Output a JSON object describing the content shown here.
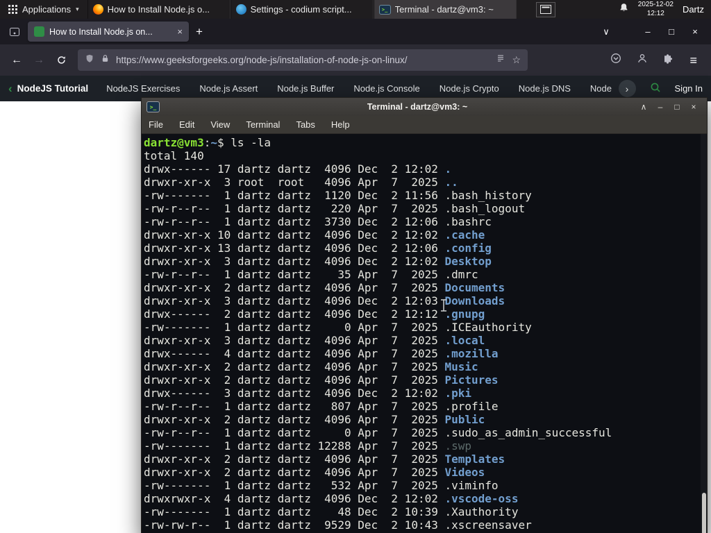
{
  "colors": {
    "terminal_green": "#8ae234",
    "terminal_blue": "#729fcf",
    "gfg_green": "#2f8d46",
    "firefox_orange": "#ff7139"
  },
  "icons": {
    "caret_down": "▾",
    "close": "×",
    "plus": "+",
    "chevron_down": "∨",
    "chevron_up": "∧",
    "chevron_left": "‹",
    "chevron_right": "›",
    "minimize": "–",
    "maximize": "□",
    "back": "←",
    "forward": "→",
    "menu": "≡",
    "star": "☆"
  },
  "panel": {
    "applications_label": "Applications",
    "tasks": [
      {
        "label": "How to Install Node.js o...",
        "app": "firefox"
      },
      {
        "label": "Settings - codium script...",
        "app": "codium"
      },
      {
        "label": "Terminal - dartz@vm3: ~",
        "app": "terminal",
        "active": true
      }
    ],
    "clock_date": "2025-12-02",
    "clock_time": "12:12",
    "user_label": "Dartz"
  },
  "browser": {
    "tab_title": "How to Install Node.js on...",
    "url": "https://www.geeksforgeeks.org/node-js/installation-of-node-js-on-linux/"
  },
  "site_nav": {
    "back_label": "NodeJS Tutorial",
    "items": [
      "NodeJS Exercises",
      "Node.js Assert",
      "Node.js Buffer",
      "Node.js Console",
      "Node.js Crypto",
      "Node.js DNS",
      "Node"
    ],
    "sign_in_label": "Sign In"
  },
  "terminal": {
    "title": "Terminal - dartz@vm3: ~",
    "menu_items": [
      "File",
      "Edit",
      "View",
      "Terminal",
      "Tabs",
      "Help"
    ],
    "prompt": {
      "user_host": "dartz@vm3",
      "separator": ":",
      "cwd": "~",
      "symbol": "$",
      "command": "ls -la"
    },
    "total_line": "total 140",
    "listing": [
      {
        "perms": "drwx------",
        "links": 17,
        "owner": "dartz",
        "group": "dartz",
        "size": 4096,
        "month": "Dec",
        "day": 2,
        "when": "12:02",
        "name": ".",
        "type": "dir"
      },
      {
        "perms": "drwxr-xr-x",
        "links": 3,
        "owner": "root",
        "group": "root",
        "size": 4096,
        "month": "Apr",
        "day": 7,
        "when": "2025",
        "name": "..",
        "type": "dir"
      },
      {
        "perms": "-rw-------",
        "links": 1,
        "owner": "dartz",
        "group": "dartz",
        "size": 1120,
        "month": "Dec",
        "day": 2,
        "when": "11:56",
        "name": ".bash_history",
        "type": "file"
      },
      {
        "perms": "-rw-r--r--",
        "links": 1,
        "owner": "dartz",
        "group": "dartz",
        "size": 220,
        "month": "Apr",
        "day": 7,
        "when": "2025",
        "name": ".bash_logout",
        "type": "file"
      },
      {
        "perms": "-rw-r--r--",
        "links": 1,
        "owner": "dartz",
        "group": "dartz",
        "size": 3730,
        "month": "Dec",
        "day": 2,
        "when": "12:06",
        "name": ".bashrc",
        "type": "file"
      },
      {
        "perms": "drwxr-xr-x",
        "links": 10,
        "owner": "dartz",
        "group": "dartz",
        "size": 4096,
        "month": "Dec",
        "day": 2,
        "when": "12:02",
        "name": ".cache",
        "type": "dir"
      },
      {
        "perms": "drwxr-xr-x",
        "links": 13,
        "owner": "dartz",
        "group": "dartz",
        "size": 4096,
        "month": "Dec",
        "day": 2,
        "when": "12:06",
        "name": ".config",
        "type": "dir"
      },
      {
        "perms": "drwxr-xr-x",
        "links": 3,
        "owner": "dartz",
        "group": "dartz",
        "size": 4096,
        "month": "Dec",
        "day": 2,
        "when": "12:02",
        "name": "Desktop",
        "type": "dir"
      },
      {
        "perms": "-rw-r--r--",
        "links": 1,
        "owner": "dartz",
        "group": "dartz",
        "size": 35,
        "month": "Apr",
        "day": 7,
        "when": "2025",
        "name": ".dmrc",
        "type": "file"
      },
      {
        "perms": "drwxr-xr-x",
        "links": 2,
        "owner": "dartz",
        "group": "dartz",
        "size": 4096,
        "month": "Apr",
        "day": 7,
        "when": "2025",
        "name": "Documents",
        "type": "dir"
      },
      {
        "perms": "drwxr-xr-x",
        "links": 3,
        "owner": "dartz",
        "group": "dartz",
        "size": 4096,
        "month": "Dec",
        "day": 2,
        "when": "12:03",
        "name": "Downloads",
        "type": "dir"
      },
      {
        "perms": "drwx------",
        "links": 2,
        "owner": "dartz",
        "group": "dartz",
        "size": 4096,
        "month": "Dec",
        "day": 2,
        "when": "12:12",
        "name": ".gnupg",
        "type": "dir"
      },
      {
        "perms": "-rw-------",
        "links": 1,
        "owner": "dartz",
        "group": "dartz",
        "size": 0,
        "month": "Apr",
        "day": 7,
        "when": "2025",
        "name": ".ICEauthority",
        "type": "file"
      },
      {
        "perms": "drwxr-xr-x",
        "links": 3,
        "owner": "dartz",
        "group": "dartz",
        "size": 4096,
        "month": "Apr",
        "day": 7,
        "when": "2025",
        "name": ".local",
        "type": "dir"
      },
      {
        "perms": "drwx------",
        "links": 4,
        "owner": "dartz",
        "group": "dartz",
        "size": 4096,
        "month": "Apr",
        "day": 7,
        "when": "2025",
        "name": ".mozilla",
        "type": "dir"
      },
      {
        "perms": "drwxr-xr-x",
        "links": 2,
        "owner": "dartz",
        "group": "dartz",
        "size": 4096,
        "month": "Apr",
        "day": 7,
        "when": "2025",
        "name": "Music",
        "type": "dir"
      },
      {
        "perms": "drwxr-xr-x",
        "links": 2,
        "owner": "dartz",
        "group": "dartz",
        "size": 4096,
        "month": "Apr",
        "day": 7,
        "when": "2025",
        "name": "Pictures",
        "type": "dir"
      },
      {
        "perms": "drwx------",
        "links": 3,
        "owner": "dartz",
        "group": "dartz",
        "size": 4096,
        "month": "Dec",
        "day": 2,
        "when": "12:02",
        "name": ".pki",
        "type": "dir"
      },
      {
        "perms": "-rw-r--r--",
        "links": 1,
        "owner": "dartz",
        "group": "dartz",
        "size": 807,
        "month": "Apr",
        "day": 7,
        "when": "2025",
        "name": ".profile",
        "type": "file"
      },
      {
        "perms": "drwxr-xr-x",
        "links": 2,
        "owner": "dartz",
        "group": "dartz",
        "size": 4096,
        "month": "Apr",
        "day": 7,
        "when": "2025",
        "name": "Public",
        "type": "dir"
      },
      {
        "perms": "-rw-r--r--",
        "links": 1,
        "owner": "dartz",
        "group": "dartz",
        "size": 0,
        "month": "Apr",
        "day": 7,
        "when": "2025",
        "name": ".sudo_as_admin_successful",
        "type": "file"
      },
      {
        "perms": "-rw-------",
        "links": 1,
        "owner": "dartz",
        "group": "dartz",
        "size": 12288,
        "month": "Apr",
        "day": 7,
        "when": "2025",
        "name": ".swp",
        "type": "dim"
      },
      {
        "perms": "drwxr-xr-x",
        "links": 2,
        "owner": "dartz",
        "group": "dartz",
        "size": 4096,
        "month": "Apr",
        "day": 7,
        "when": "2025",
        "name": "Templates",
        "type": "dir"
      },
      {
        "perms": "drwxr-xr-x",
        "links": 2,
        "owner": "dartz",
        "group": "dartz",
        "size": 4096,
        "month": "Apr",
        "day": 7,
        "when": "2025",
        "name": "Videos",
        "type": "dir"
      },
      {
        "perms": "-rw-------",
        "links": 1,
        "owner": "dartz",
        "group": "dartz",
        "size": 532,
        "month": "Apr",
        "day": 7,
        "when": "2025",
        "name": ".viminfo",
        "type": "file"
      },
      {
        "perms": "drwxrwxr-x",
        "links": 4,
        "owner": "dartz",
        "group": "dartz",
        "size": 4096,
        "month": "Dec",
        "day": 2,
        "when": "12:02",
        "name": ".vscode-oss",
        "type": "dir"
      },
      {
        "perms": "-rw-------",
        "links": 1,
        "owner": "dartz",
        "group": "dartz",
        "size": 48,
        "month": "Dec",
        "day": 2,
        "when": "10:39",
        "name": ".Xauthority",
        "type": "file"
      },
      {
        "perms": "-rw-rw-r--",
        "links": 1,
        "owner": "dartz",
        "group": "dartz",
        "size": 9529,
        "month": "Dec",
        "day": 2,
        "when": "10:43",
        "name": ".xscreensaver",
        "type": "file"
      }
    ]
  }
}
